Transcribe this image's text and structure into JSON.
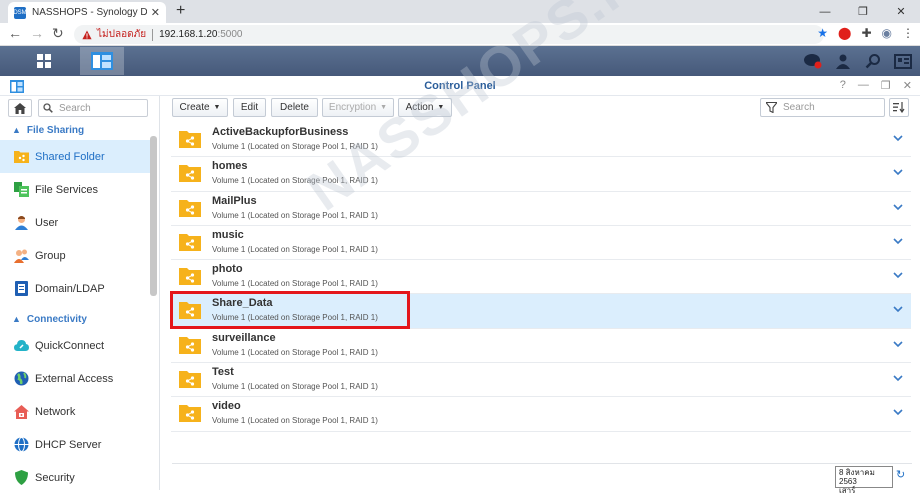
{
  "browser": {
    "tab_title": "NASSHOPS - Synology DiskStation",
    "favicon_text": "DSM",
    "new_tab": "+",
    "insecure_label": "ไม่ปลอดภัย",
    "url_host": "192.168.1.20",
    "url_port": ":5000"
  },
  "window": {
    "title": "Control Panel"
  },
  "sidebar": {
    "search_placeholder": "Search",
    "section_file_sharing": "File Sharing",
    "section_connectivity": "Connectivity",
    "items": [
      {
        "label": "Shared Folder"
      },
      {
        "label": "File Services"
      },
      {
        "label": "User"
      },
      {
        "label": "Group"
      },
      {
        "label": "Domain/LDAP"
      },
      {
        "label": "QuickConnect"
      },
      {
        "label": "External Access"
      },
      {
        "label": "Network"
      },
      {
        "label": "DHCP Server"
      },
      {
        "label": "Security"
      }
    ]
  },
  "toolbar": {
    "create": "Create",
    "edit": "Edit",
    "delete": "Delete",
    "encryption": "Encryption",
    "action": "Action",
    "filter_placeholder": "Search"
  },
  "folders": [
    {
      "name": "ActiveBackupforBusiness",
      "desc": "Volume 1 (Located on Storage Pool 1, RAID 1)"
    },
    {
      "name": "homes",
      "desc": "Volume 1 (Located on Storage Pool 1, RAID 1)"
    },
    {
      "name": "MailPlus",
      "desc": "Volume 1 (Located on Storage Pool 1, RAID 1)"
    },
    {
      "name": "music",
      "desc": "Volume 1 (Located on Storage Pool 1, RAID 1)"
    },
    {
      "name": "photo",
      "desc": "Volume 1 (Located on Storage Pool 1, RAID 1)"
    },
    {
      "name": "Share_Data",
      "desc": "Volume 1 (Located on Storage Pool 1, RAID 1)"
    },
    {
      "name": "surveillance",
      "desc": "Volume 1 (Located on Storage Pool 1, RAID 1)"
    },
    {
      "name": "Test",
      "desc": "Volume 1 (Located on Storage Pool 1, RAID 1)"
    },
    {
      "name": "video",
      "desc": "Volume 1 (Located on Storage Pool 1, RAID 1)"
    }
  ],
  "selected_folder": "Share_Data",
  "watermark": "NASSHOPS.net",
  "datetime": {
    "line1": "8 สิงหาคม 2563",
    "line2": "เสาร์"
  },
  "colors": {
    "accent": "#1f6fc5",
    "folder": "#f6b21b",
    "highlight": "#e4161b",
    "selected_row": "#dbeefd"
  }
}
